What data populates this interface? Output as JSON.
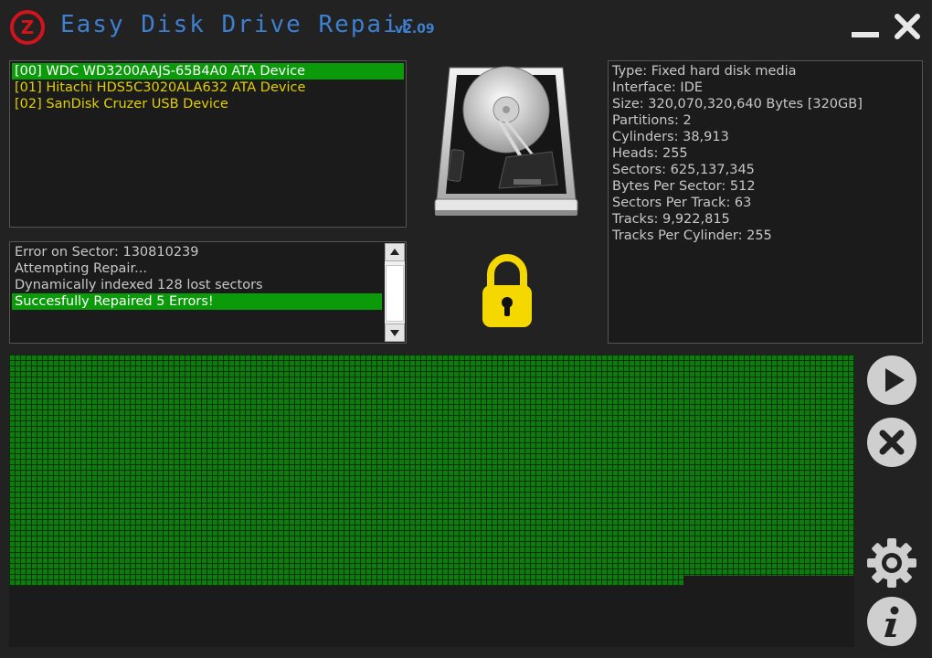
{
  "window": {
    "title": "Easy Disk Drive Repair",
    "version": "v2.09",
    "logo_letter": "Z",
    "colors": {
      "title": "#3e7fd0",
      "logo": "#d0141c",
      "selection": "#0a9a0a",
      "device_text": "#e0d000",
      "lock": "#f5d800",
      "sector": "#0c7d0c"
    }
  },
  "devices": [
    {
      "label": "[00] WDC WD3200AAJS-65B4A0 ATA Device",
      "selected": true
    },
    {
      "label": "[01] Hitachi HDS5C3020ALA632 ATA Device",
      "selected": false
    },
    {
      "label": "[02] SanDisk Cruzer USB Device",
      "selected": false
    }
  ],
  "log": [
    "Error on Sector: 130810239",
    "Attempting Repair...",
    "Dynamically indexed 128 lost sectors",
    "Succesfully Repaired 5 Errors!"
  ],
  "drive_info": [
    "Type: Fixed hard disk media",
    "Interface: IDE",
    "Size: 320,070,320,640 Bytes [320GB]",
    "Partitions: 2",
    "Cylinders: 38,913",
    "Heads: 255",
    "Sectors: 625,137,345",
    "Bytes Per Sector: 512",
    "Sectors Per Track: 63",
    "Tracks: 9,922,815",
    "Tracks Per Cylinder: 255"
  ],
  "icons": {
    "drive": "hard-drive-icon",
    "lock": "lock-icon",
    "play": "play-icon",
    "stop": "stop-icon",
    "settings": "gear-icon",
    "info": "info-icon",
    "minimize": "minimize-icon",
    "close": "close-icon"
  },
  "sector_map": {
    "progress_rows_full": 40,
    "last_row_fraction": 0.8
  }
}
